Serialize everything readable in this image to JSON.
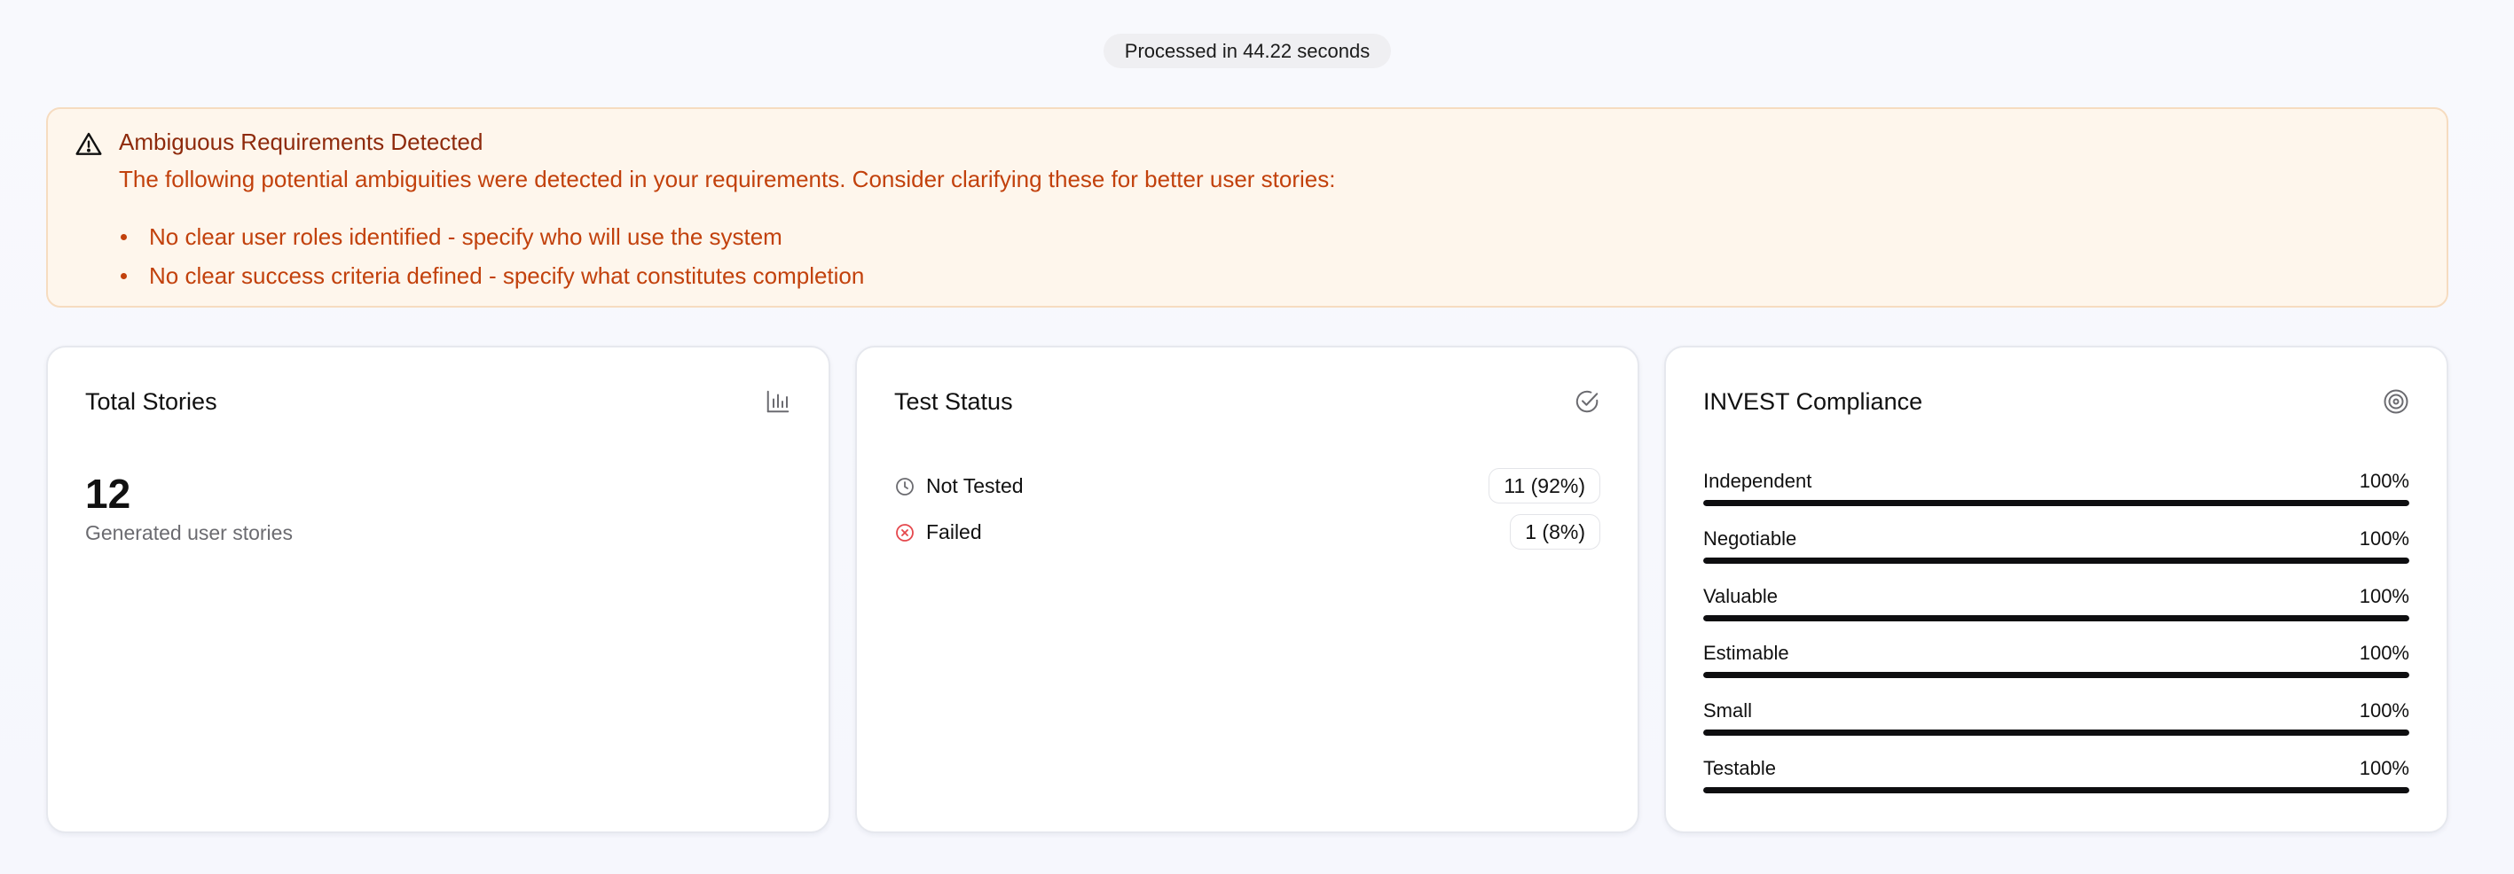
{
  "processed": {
    "text": "Processed in 44.22 seconds"
  },
  "alert": {
    "icon": "alert-triangle-icon",
    "title": "Ambiguous Requirements Detected",
    "description": "The following potential ambiguities were detected in your requirements. Consider clarifying these for better user stories:",
    "items": [
      "No clear user roles identified - specify who will use the system",
      "No clear success criteria defined - specify what constitutes completion"
    ],
    "colors": {
      "title": "#8e2a0c",
      "text": "#c2410c",
      "background": "#fef6ec",
      "border": "#f6dcc0"
    }
  },
  "cards": {
    "total_stories": {
      "title": "Total Stories",
      "icon": "bar-chart-icon",
      "value": "12",
      "label": "Generated user stories"
    },
    "test_status": {
      "title": "Test Status",
      "icon": "check-circle-icon",
      "rows": [
        {
          "icon": "clock-icon",
          "label": "Not Tested",
          "badge": "11 (92%)"
        },
        {
          "icon": "x-circle-icon",
          "label": "Failed",
          "badge": "1 (8%)"
        }
      ]
    },
    "invest": {
      "title": "INVEST Compliance",
      "icon": "target-icon",
      "metrics": [
        {
          "label": "Independent",
          "value": "100%",
          "percent": 100
        },
        {
          "label": "Negotiable",
          "value": "100%",
          "percent": 100
        },
        {
          "label": "Valuable",
          "value": "100%",
          "percent": 100
        },
        {
          "label": "Estimable",
          "value": "100%",
          "percent": 100
        },
        {
          "label": "Small",
          "value": "100%",
          "percent": 100
        },
        {
          "label": "Testable",
          "value": "100%",
          "percent": 100
        }
      ]
    }
  }
}
